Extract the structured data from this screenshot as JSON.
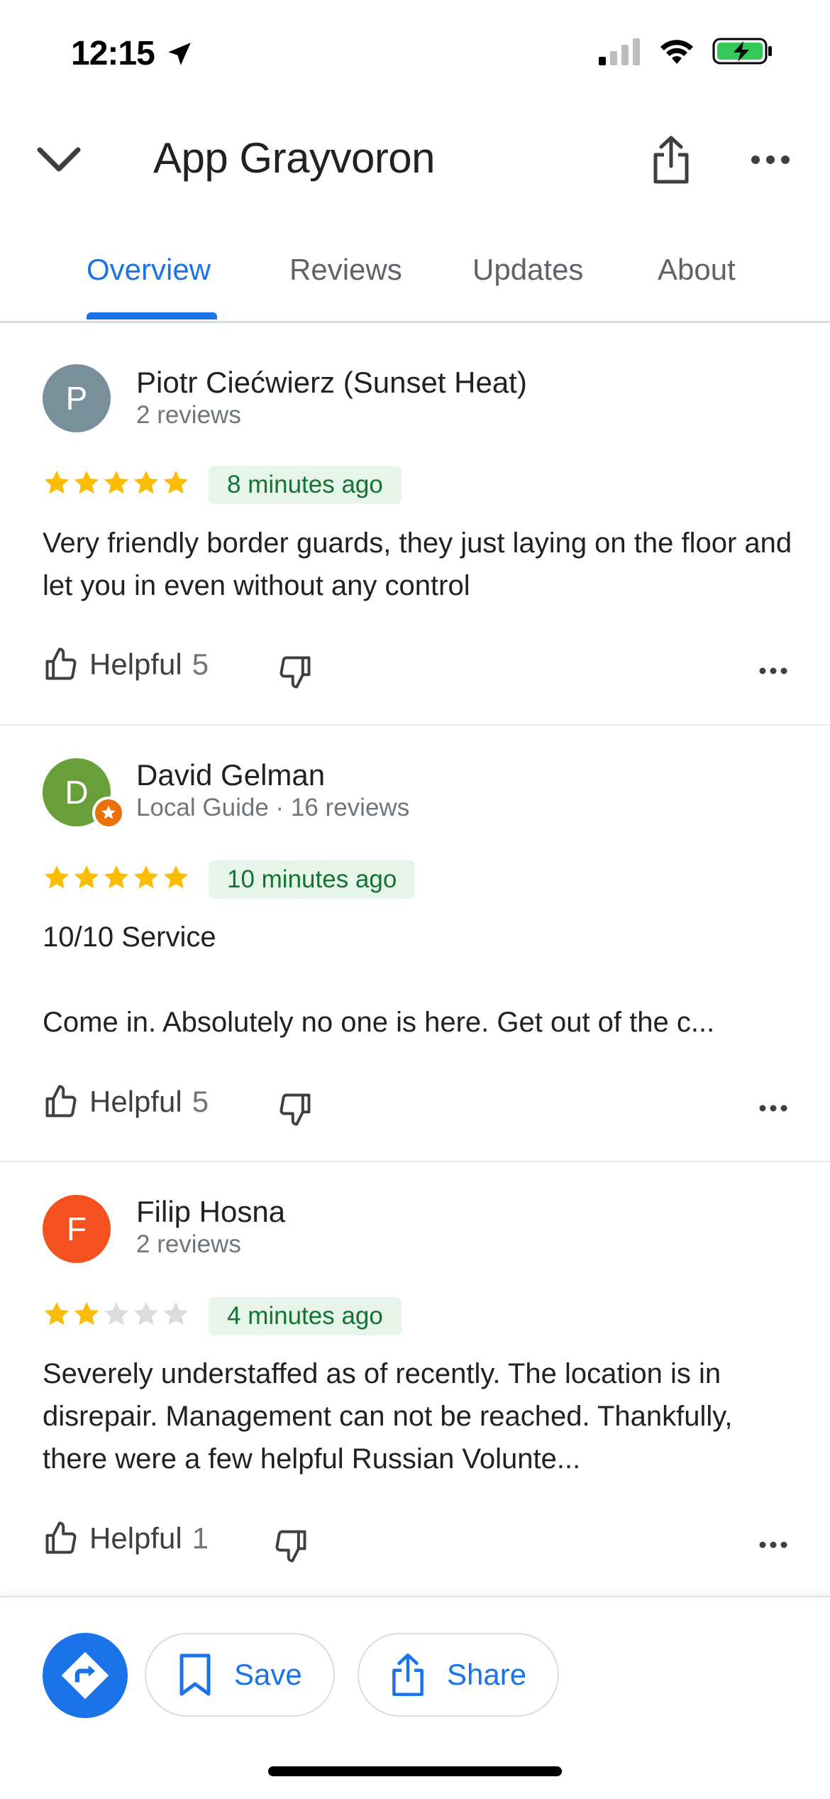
{
  "status_bar": {
    "time": "12:15",
    "location_icon": "location-arrow-icon",
    "signal_icon": "cellular-signal-icon",
    "wifi_icon": "wifi-icon",
    "battery_icon": "battery-charging-icon"
  },
  "header": {
    "title": "App Grayvoron",
    "back_icon": "chevron-down-icon",
    "share_icon": "share-icon",
    "more_icon": "more-horizontal-icon"
  },
  "tabs": [
    {
      "label": "Overview",
      "active": true
    },
    {
      "label": "Reviews",
      "active": false
    },
    {
      "label": "Updates",
      "active": false
    },
    {
      "label": "About",
      "active": false
    }
  ],
  "reviews": [
    {
      "name": "Piotr Ciećwierz (Sunset Heat)",
      "meta": "2 reviews",
      "initial": "P",
      "avatar_color": "#78909c",
      "local_guide": false,
      "rating": 5,
      "time": "8 minutes ago",
      "text": "Very friendly border guards, they just laying on the floor and let you in even without any control",
      "helpful_label": "Helpful",
      "helpful_count": "5"
    },
    {
      "name": "David Gelman",
      "meta": "Local Guide · 16 reviews",
      "initial": "D",
      "avatar_color": "#689f38",
      "local_guide": true,
      "rating": 5,
      "time": "10 minutes ago",
      "text": "10/10 Service\n\nCome in. Absolutely no one is here. Get out of the c...",
      "helpful_label": "Helpful",
      "helpful_count": "5"
    },
    {
      "name": "Filip Hosna",
      "meta": "2 reviews",
      "initial": "F",
      "avatar_color": "#f4511e",
      "local_guide": false,
      "rating": 2,
      "time": "4 minutes ago",
      "text": "Severely understaffed as of recently. The location is in disrepair. Management can not be reached. Thankfully, there were a few helpful Russian Volunte...",
      "helpful_label": "Helpful",
      "helpful_count": "1"
    }
  ],
  "bottom_bar": {
    "directions_icon": "directions-icon",
    "save_label": "Save",
    "save_icon": "bookmark-icon",
    "share_label": "Share",
    "share_icon": "share-icon"
  },
  "colors": {
    "accent": "#1a73e8",
    "star": "#fbbc04",
    "star_empty": "#dadce0",
    "chip_bg": "#e6f4ea",
    "chip_text": "#137333"
  }
}
